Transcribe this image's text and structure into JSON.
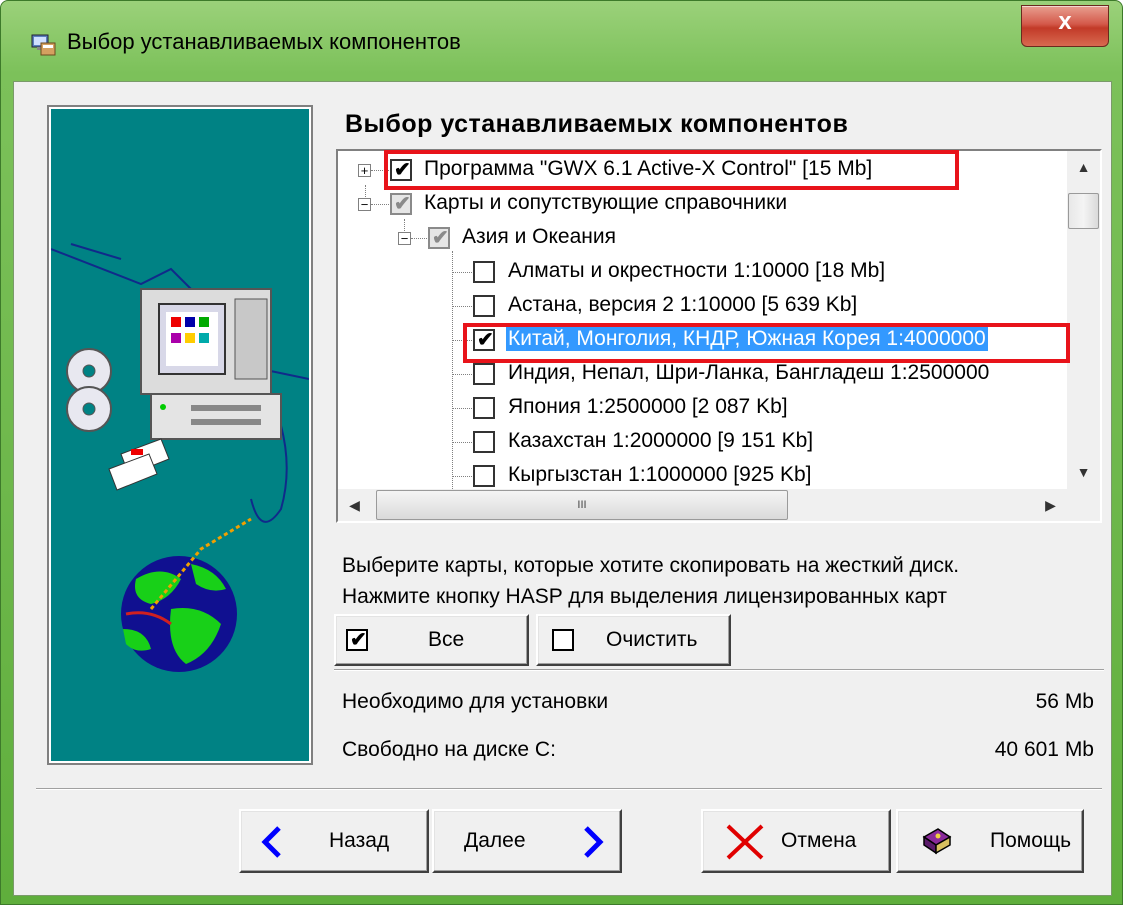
{
  "window": {
    "title": "Выбор устанавливаемых компонентов",
    "close_label": "x"
  },
  "heading": "Выбор устанавливаемых компонентов",
  "tree": [
    {
      "label": "Программа \"GWX 6.1 Active-X Control\" [15 Mb]",
      "checked": true,
      "expander": "+"
    },
    {
      "label": "Карты и сопутствующие справочники",
      "checked": true,
      "grey": true,
      "expander": "−"
    },
    {
      "label": "Азия и Океания",
      "checked": true,
      "grey": true,
      "expander": "−"
    },
    {
      "label": "Алматы и окрестности 1:10000 [18 Mb]",
      "checked": false
    },
    {
      "label": "Астана, версия 2 1:10000 [5 639 Kb]",
      "checked": false
    },
    {
      "label": "Китай, Монголия, КНДР, Южная Корея 1:4000000",
      "checked": true,
      "selected": true
    },
    {
      "label": "Индия, Непал, Шри-Ланка, Бангладеш 1:2500000",
      "checked": false
    },
    {
      "label": "Япония 1:2500000 [2 087 Kb]",
      "checked": false
    },
    {
      "label": "Казахстан 1:2000000 [9 151 Kb]",
      "checked": false
    },
    {
      "label": "Кыргызстан 1:1000000 [925 Kb]",
      "checked": false
    }
  ],
  "scroll": {
    "h_thumb_grip": "III"
  },
  "info": {
    "line1": "Выберите карты, которые хотите скопировать на жесткий диск.",
    "line2": "Нажмите кнопку HASP для выделения лицензированных карт"
  },
  "buttons": {
    "all": "Все",
    "clear": "Очистить",
    "back": "Назад",
    "next": "Далее",
    "cancel": "Отмена",
    "help": "Помощь"
  },
  "stats": {
    "required_label": "Необходимо для установки",
    "required_value": "56 Mb",
    "free_label": "Свободно на диске С:",
    "free_value": "40 601 Mb"
  },
  "colors": {
    "highlight": "#e8131a",
    "selection": "#3399ff",
    "side_panel": "#008284"
  },
  "icons": [
    "setup-icon",
    "computer-icon",
    "cd-icon",
    "floppy-icon",
    "globe-icon",
    "back-arrow-icon",
    "next-arrow-icon",
    "cancel-x-icon",
    "help-book-icon"
  ]
}
